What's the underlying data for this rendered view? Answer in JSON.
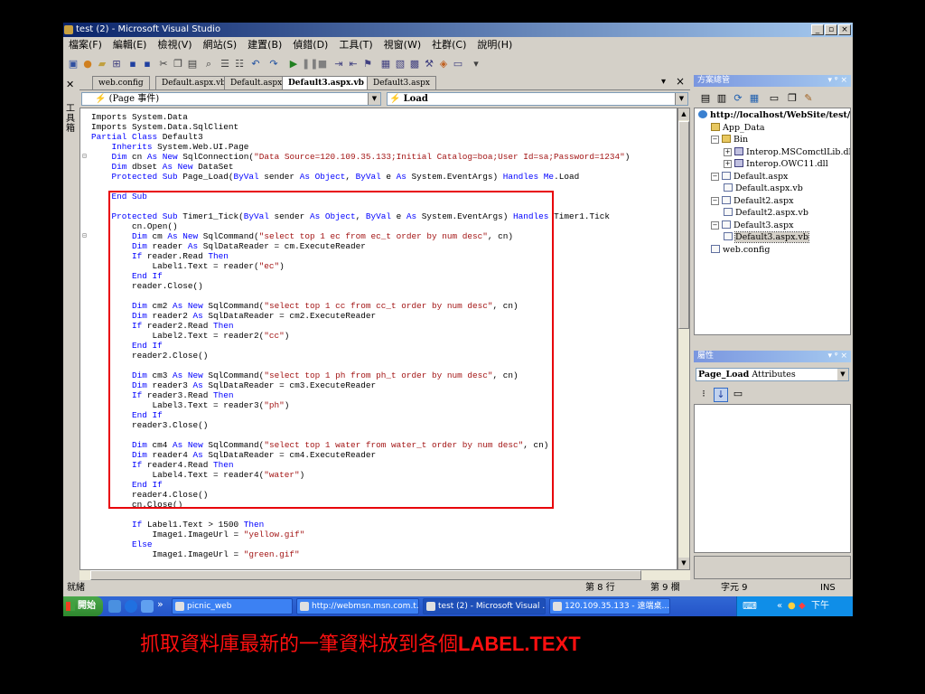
{
  "window": {
    "title": "test (2) - Microsoft Visual Studio",
    "controls": {
      "minimize": "_",
      "maximize": "▫",
      "close": "×"
    }
  },
  "menu": [
    "檔案(F)",
    "編輯(E)",
    "檢視(V)",
    "網站(S)",
    "建置(B)",
    "偵錯(D)",
    "工具(T)",
    "視窗(W)",
    "社群(C)",
    "說明(H)"
  ],
  "toolbox_label": "工具箱",
  "doc_tabs": [
    "web.config",
    "Default.aspx.vb",
    "Default.aspx",
    "Default3.aspx.vb",
    "Default3.aspx"
  ],
  "active_tab": "Default3.aspx.vb",
  "tab_controls": {
    "dropdown": "▾",
    "close": "×"
  },
  "object_combo": "(Page 事件)",
  "event_combo": "Load",
  "code_lines": [
    [
      [
        "",
        "Imports System.Data"
      ]
    ],
    [
      [
        "",
        "Imports System.Data.SqlClient"
      ]
    ],
    [
      [
        "kw",
        "Partial Class"
      ],
      [
        "",
        " Default3"
      ]
    ],
    [
      [
        "kw",
        "    Inherits"
      ],
      [
        "",
        " System.Web.UI.Page"
      ]
    ],
    [
      [
        "kw",
        "    Dim"
      ],
      [
        "",
        " cn "
      ],
      [
        "kw",
        "As New"
      ],
      [
        "",
        " SqlConnection("
      ],
      [
        "str",
        "\"Data Source=120.109.35.133;Initial Catalog=boa;User Id=sa;Password=1234\""
      ],
      [
        "",
        ")"
      ]
    ],
    [
      [
        "kw",
        "    Dim"
      ],
      [
        "",
        " dbset "
      ],
      [
        "kw",
        "As New"
      ],
      [
        "",
        " DataSet"
      ]
    ],
    [
      [
        "kw",
        "    Protected Sub"
      ],
      [
        "",
        " Page_Load("
      ],
      [
        "kw",
        "ByVal"
      ],
      [
        "",
        " sender "
      ],
      [
        "kw",
        "As Object"
      ],
      [
        "",
        ", "
      ],
      [
        "kw",
        "ByVal"
      ],
      [
        "",
        " e "
      ],
      [
        "kw",
        "As"
      ],
      [
        "",
        " System.EventArgs) "
      ],
      [
        "kw",
        "Handles Me"
      ],
      [
        "",
        ".Load"
      ]
    ],
    [
      [
        "",
        ""
      ]
    ],
    [
      [
        "kw",
        "    End Sub"
      ]
    ],
    [
      [
        "",
        ""
      ]
    ],
    [
      [
        "kw",
        "    Protected Sub"
      ],
      [
        "",
        " Timer1_Tick("
      ],
      [
        "kw",
        "ByVal"
      ],
      [
        "",
        " sender "
      ],
      [
        "kw",
        "As Object"
      ],
      [
        "",
        ", "
      ],
      [
        "kw",
        "ByVal"
      ],
      [
        "",
        " e "
      ],
      [
        "kw",
        "As"
      ],
      [
        "",
        " System.EventArgs) "
      ],
      [
        "kw",
        "Handles"
      ],
      [
        "",
        " Timer1.Tick"
      ]
    ],
    [
      [
        "",
        "        cn.Open()"
      ]
    ],
    [
      [
        "kw",
        "        Dim"
      ],
      [
        "",
        " cm "
      ],
      [
        "kw",
        "As New"
      ],
      [
        "",
        " SqlCommand("
      ],
      [
        "str",
        "\"select top 1 ec from ec_t order by num desc\""
      ],
      [
        "",
        ", cn)"
      ]
    ],
    [
      [
        "kw",
        "        Dim"
      ],
      [
        "",
        " reader "
      ],
      [
        "kw",
        "As"
      ],
      [
        "",
        " SqlDataReader = cm.ExecuteReader"
      ]
    ],
    [
      [
        "kw",
        "        If"
      ],
      [
        "",
        " reader.Read "
      ],
      [
        "kw",
        "Then"
      ]
    ],
    [
      [
        "",
        "            Label1.Text = reader("
      ],
      [
        "str",
        "\"ec\""
      ],
      [
        "",
        ")"
      ]
    ],
    [
      [
        "kw",
        "        End If"
      ]
    ],
    [
      [
        "",
        "        reader.Close()"
      ]
    ],
    [
      [
        "",
        ""
      ]
    ],
    [
      [
        "kw",
        "        Dim"
      ],
      [
        "",
        " cm2 "
      ],
      [
        "kw",
        "As New"
      ],
      [
        "",
        " SqlCommand("
      ],
      [
        "str",
        "\"select top 1 cc from cc_t order by num desc\""
      ],
      [
        "",
        ", cn)"
      ]
    ],
    [
      [
        "kw",
        "        Dim"
      ],
      [
        "",
        " reader2 "
      ],
      [
        "kw",
        "As"
      ],
      [
        "",
        " SqlDataReader = cm2.ExecuteReader"
      ]
    ],
    [
      [
        "kw",
        "        If"
      ],
      [
        "",
        " reader2.Read "
      ],
      [
        "kw",
        "Then"
      ]
    ],
    [
      [
        "",
        "            Label2.Text = reader2("
      ],
      [
        "str",
        "\"cc\""
      ],
      [
        "",
        ")"
      ]
    ],
    [
      [
        "kw",
        "        End If"
      ]
    ],
    [
      [
        "",
        "        reader2.Close()"
      ]
    ],
    [
      [
        "",
        ""
      ]
    ],
    [
      [
        "kw",
        "        Dim"
      ],
      [
        "",
        " cm3 "
      ],
      [
        "kw",
        "As New"
      ],
      [
        "",
        " SqlCommand("
      ],
      [
        "str",
        "\"select top 1 ph from ph_t order by num desc\""
      ],
      [
        "",
        ", cn)"
      ]
    ],
    [
      [
        "kw",
        "        Dim"
      ],
      [
        "",
        " reader3 "
      ],
      [
        "kw",
        "As"
      ],
      [
        "",
        " SqlDataReader = cm3.ExecuteReader"
      ]
    ],
    [
      [
        "kw",
        "        If"
      ],
      [
        "",
        " reader3.Read "
      ],
      [
        "kw",
        "Then"
      ]
    ],
    [
      [
        "",
        "            Label3.Text = reader3("
      ],
      [
        "str",
        "\"ph\""
      ],
      [
        "",
        ")"
      ]
    ],
    [
      [
        "kw",
        "        End If"
      ]
    ],
    [
      [
        "",
        "        reader3.Close()"
      ]
    ],
    [
      [
        "",
        ""
      ]
    ],
    [
      [
        "kw",
        "        Dim"
      ],
      [
        "",
        " cm4 "
      ],
      [
        "kw",
        "As New"
      ],
      [
        "",
        " SqlCommand("
      ],
      [
        "str",
        "\"select top 1 water from water_t order by num desc\""
      ],
      [
        "",
        ", cn)"
      ]
    ],
    [
      [
        "kw",
        "        Dim"
      ],
      [
        "",
        " reader4 "
      ],
      [
        "kw",
        "As"
      ],
      [
        "",
        " SqlDataReader = cm4.ExecuteReader"
      ]
    ],
    [
      [
        "kw",
        "        If"
      ],
      [
        "",
        " reader4.Read "
      ],
      [
        "kw",
        "Then"
      ]
    ],
    [
      [
        "",
        "            Label4.Text = reader4("
      ],
      [
        "str",
        "\"water\""
      ],
      [
        "",
        ")"
      ]
    ],
    [
      [
        "kw",
        "        End If"
      ]
    ],
    [
      [
        "",
        "        reader4.Close()"
      ]
    ],
    [
      [
        "",
        "        cn.Close()"
      ]
    ],
    [
      [
        "",
        ""
      ]
    ],
    [
      [
        "kw",
        "        If"
      ],
      [
        "",
        " Label1.Text > 1500 "
      ],
      [
        "kw",
        "Then"
      ]
    ],
    [
      [
        "",
        "            Image1.ImageUrl = "
      ],
      [
        "str",
        "\"yellow.gif\""
      ]
    ],
    [
      [
        "kw",
        "        Else"
      ]
    ],
    [
      [
        "",
        "            Image1.ImageUrl = "
      ],
      [
        "str",
        "\"green.gif\""
      ]
    ]
  ],
  "solution_panel": {
    "title": "方案總管",
    "controls": "▾ ᵠ ×",
    "tree": [
      {
        "label": "http://localhost/WebSite/test/",
        "icon": "web",
        "indent": 0,
        "expander": "",
        "bold": true
      },
      {
        "label": "App_Data",
        "icon": "folder",
        "indent": 1,
        "expander": ""
      },
      {
        "label": "Bin",
        "icon": "folder",
        "indent": 1,
        "expander": "−"
      },
      {
        "label": "Interop.MSComctlLib.dll",
        "icon": "dll",
        "indent": 2,
        "expander": "+"
      },
      {
        "label": "Interop.OWC11.dll",
        "icon": "dll",
        "indent": 2,
        "expander": "+"
      },
      {
        "label": "Default.aspx",
        "icon": "file",
        "indent": 1,
        "expander": "−"
      },
      {
        "label": "Default.aspx.vb",
        "icon": "file",
        "indent": 2,
        "expander": ""
      },
      {
        "label": "Default2.aspx",
        "icon": "file",
        "indent": 1,
        "expander": "−"
      },
      {
        "label": "Default2.aspx.vb",
        "icon": "file",
        "indent": 2,
        "expander": ""
      },
      {
        "label": "Default3.aspx",
        "icon": "file",
        "indent": 1,
        "expander": "−"
      },
      {
        "label": "Default3.aspx.vb",
        "icon": "file",
        "indent": 2,
        "expander": "",
        "selected": true
      },
      {
        "label": "web.config",
        "icon": "file",
        "indent": 1,
        "expander": ""
      }
    ]
  },
  "properties_panel": {
    "title": "屬性",
    "controls": "▾ ᵠ ×",
    "selected_name": "Page_Load",
    "selected_type": "Attributes"
  },
  "status": {
    "ready": "就緒",
    "line": "第 8 行",
    "col": "第 9 欄",
    "char": "字元 9",
    "mode": "INS"
  },
  "taskbar": {
    "start": "開始",
    "more": "»",
    "tasks": [
      {
        "label": "picnic_web"
      },
      {
        "label": "http://webmsn.msn.com.t..."
      },
      {
        "label": "test (2) - Microsoft Visual ...",
        "active": true
      },
      {
        "label": "120.109.35.133 - 遠端桌..."
      }
    ],
    "tray_more": "«",
    "clock": "下午 04:24"
  },
  "caption": {
    "prefix": "抓取資料庫最新的一筆資料放到各個",
    "suffix": "LABEL.TEXT"
  },
  "colors": {
    "keyword": "#0000ff",
    "string": "#a31515",
    "highlight_box": "#e8000a",
    "caption": "#ff1010",
    "titlebar": "#0a246a"
  }
}
